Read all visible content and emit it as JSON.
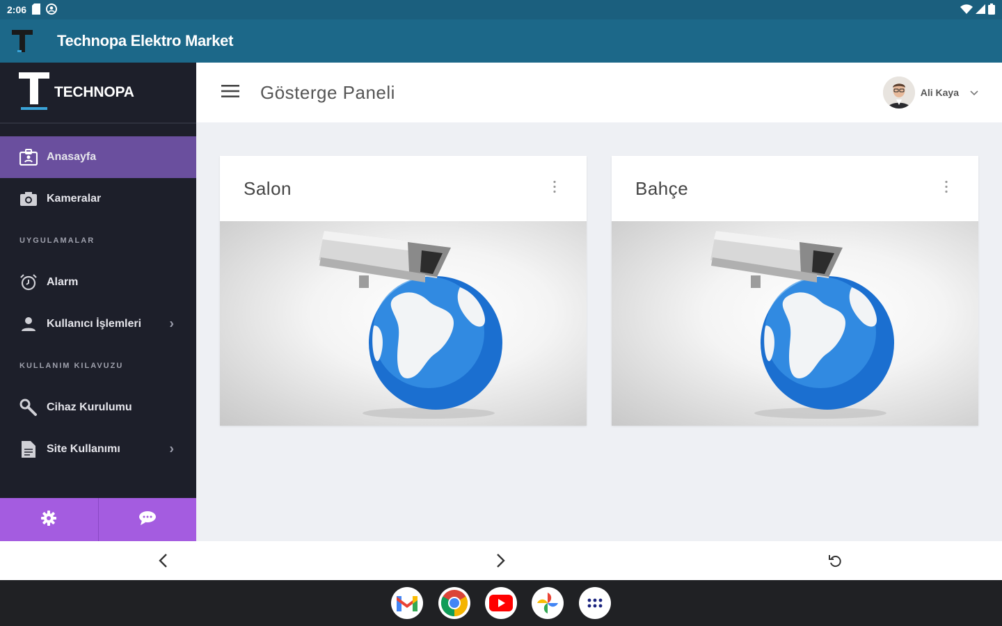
{
  "status_bar": {
    "time": "2:06",
    "icons": [
      "sim-card-icon",
      "account-icon",
      "wifi-icon",
      "signal-icon",
      "battery-icon"
    ]
  },
  "app_bar": {
    "title": "Technopa Elektro Market",
    "logo_letter": "T"
  },
  "sidebar": {
    "brand": "TECHNOPA",
    "items": [
      {
        "label": "Anasayfa",
        "icon": "dashboard-icon",
        "active": true
      },
      {
        "label": "Kameralar",
        "icon": "camera-icon",
        "active": false
      }
    ],
    "section_apps": "UYGULAMALAR",
    "apps": [
      {
        "label": "Alarm",
        "icon": "alarm-icon"
      },
      {
        "label": "Kullanıcı İşlemleri",
        "icon": "user-icon",
        "has_children": true
      }
    ],
    "section_guide": "KULLANIM KILAVUZU",
    "guide": [
      {
        "label": "Cihaz Kurulumu",
        "icon": "wrench-icon"
      },
      {
        "label": "Site Kullanımı",
        "icon": "document-icon",
        "has_children": true
      }
    ],
    "footer": [
      "settings-icon",
      "chat-icon"
    ]
  },
  "topbar": {
    "title": "Gösterge Paneli",
    "user_name": "Ali Kaya"
  },
  "cards": [
    {
      "title": "Salon",
      "image": "security-camera-globe"
    },
    {
      "title": "Bahçe",
      "image": "security-camera-globe"
    }
  ],
  "browser_nav": [
    "back-icon",
    "forward-icon",
    "reload-icon"
  ],
  "dock": [
    "gmail",
    "chrome",
    "youtube",
    "photos",
    "app-drawer"
  ],
  "colors": {
    "status_bar": "#1b5f7e",
    "app_bar": "#1c6889",
    "sidebar": "#1d1f2a",
    "active_item": "#6a4f9e",
    "sidebar_footer": "#a45ce0",
    "content_bg": "#eef0f4"
  }
}
